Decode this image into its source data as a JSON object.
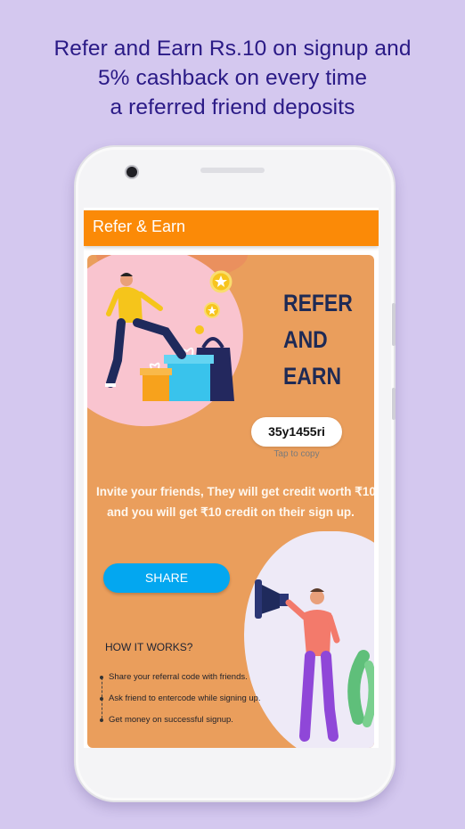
{
  "headline": {
    "line1": "Refer and Earn Rs.10 on signup and",
    "line2": "5% cashback on every time",
    "line3": "a referred friend deposits"
  },
  "appbar": {
    "title": "Refer & Earn"
  },
  "card": {
    "title_line1": "REFER",
    "title_line2": "AND",
    "title_line3": "EARN",
    "referral_code": "35y1455ri",
    "tap_to_copy": "Tap to copy",
    "invite_line1": "Invite your friends, They will get credit worth ₹10",
    "invite_line2": "and you will get ₹10 credit on their sign up.",
    "share_label": "SHARE",
    "how_title": "HOW IT WORKS?",
    "steps": [
      "Share your referral code with friends.",
      "Ask friend to entercode while signing up.",
      "Get money on successful signup."
    ]
  },
  "colors": {
    "background": "#d4c8ef",
    "headline": "#2a1a86",
    "appbar": "#fb8a07",
    "card": "#ea9e5c",
    "share_button": "#03a7f0"
  }
}
